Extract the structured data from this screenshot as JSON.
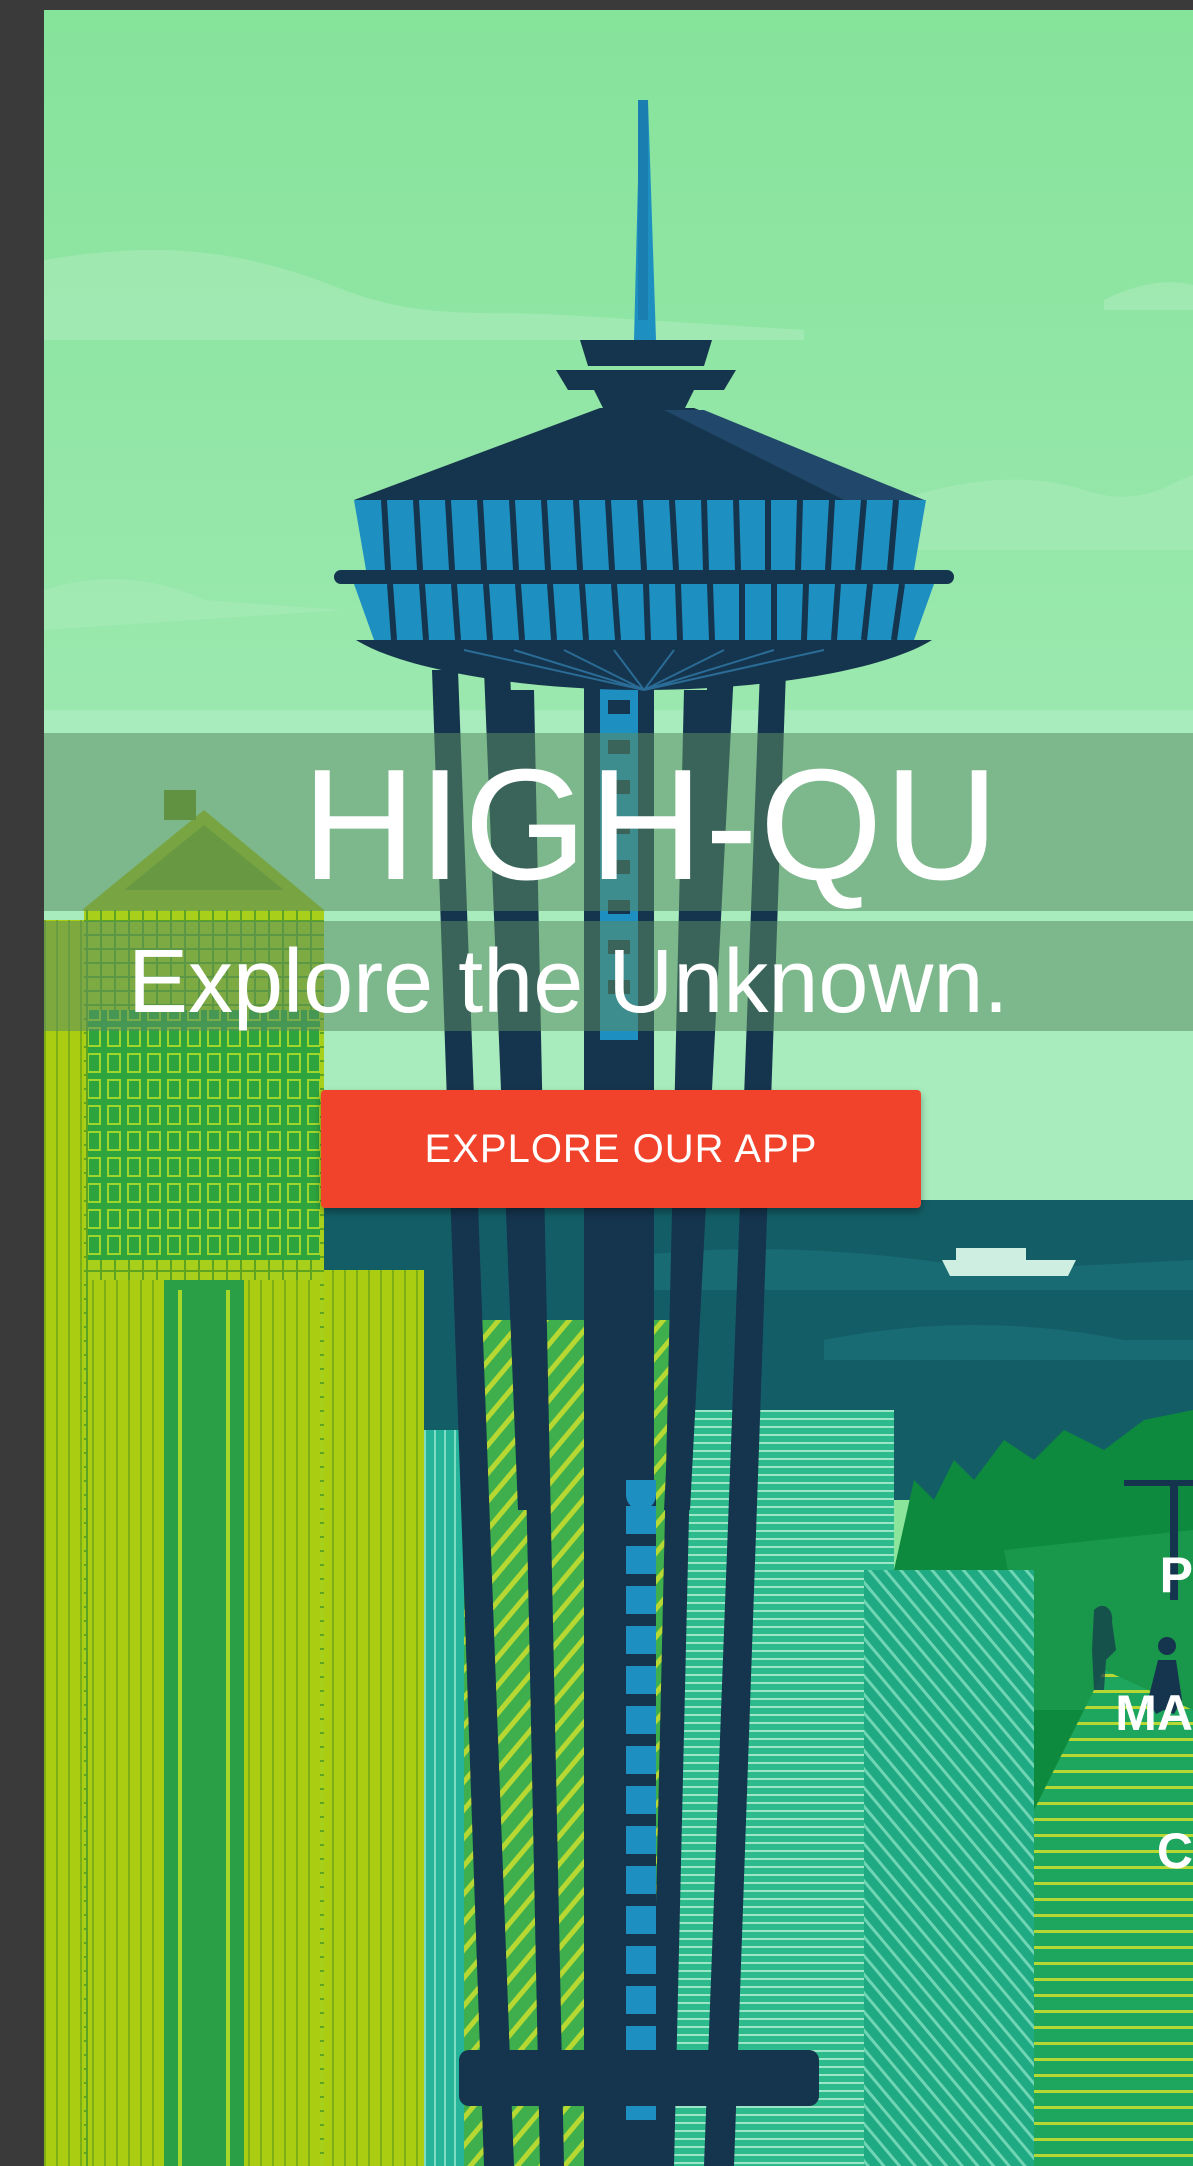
{
  "hero": {
    "title": "HIGH-QU",
    "subtitle": "Explore the Unknown.",
    "cta_label": "EXPLORE OUR APP"
  },
  "illustration": {
    "sign_lines": [
      "P",
      "MA",
      "C"
    ]
  },
  "colors": {
    "sky": "#8be59b",
    "water": "#135e66",
    "tower": "#15344d",
    "tower_accent": "#1e8fc1",
    "cta": "#f1432b",
    "building_yellow": "#a4c615",
    "building_green": "#1ea55e"
  }
}
